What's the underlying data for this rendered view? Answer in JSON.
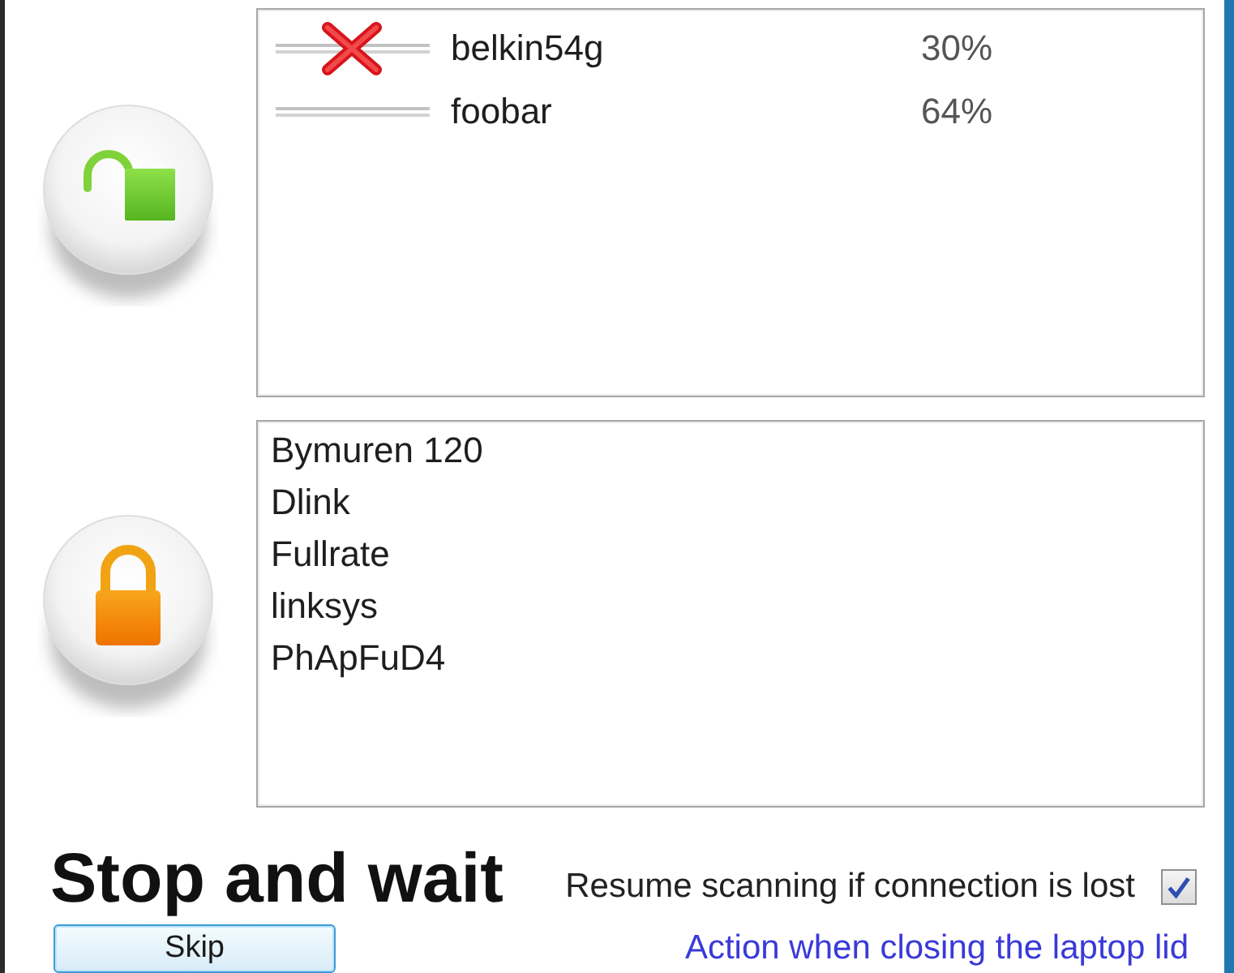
{
  "panels": [
    {
      "locked": false,
      "items": [
        {
          "name": "belkin54g",
          "signal": "30%",
          "failed": true
        },
        {
          "name": "foobar",
          "signal": "64%",
          "failed": false
        }
      ]
    },
    {
      "locked": true,
      "items": [
        {
          "name": "Bymuren 120"
        },
        {
          "name": "Dlink"
        },
        {
          "name": "Fullrate"
        },
        {
          "name": "linksys"
        },
        {
          "name": "PhApFuD4"
        }
      ]
    }
  ],
  "status": {
    "title": "Stop and wait"
  },
  "resume_option": {
    "label": "Resume scanning if connection is lost",
    "checked": true
  },
  "buttons": [
    {
      "label": "Skip"
    }
  ],
  "lid_link": {
    "label": "Action when closing the laptop lid"
  }
}
